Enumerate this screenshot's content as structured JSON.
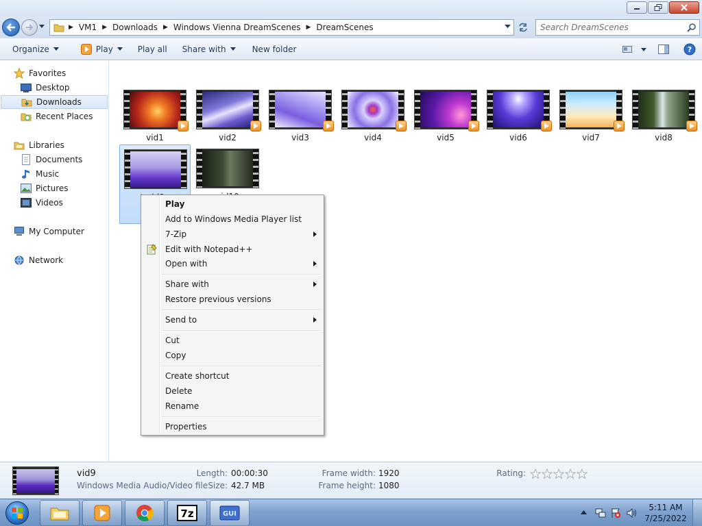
{
  "breadcrumb": [
    "VM1",
    "Downloads",
    "Windows Vienna DreamScenes",
    "DreamScenes"
  ],
  "search": {
    "placeholder": "Search DreamScenes"
  },
  "toolbar": {
    "organize": "Organize",
    "play": "Play",
    "play_all": "Play all",
    "share_with": "Share with",
    "new_folder": "New folder"
  },
  "nav": {
    "favorites": "Favorites",
    "desktop": "Desktop",
    "downloads": "Downloads",
    "recent_places": "Recent Places",
    "libraries": "Libraries",
    "documents": "Documents",
    "music": "Music",
    "pictures": "Pictures",
    "videos": "Videos",
    "my_computer": "My Computer",
    "network": "Network"
  },
  "files": [
    {
      "name": "vid1"
    },
    {
      "name": "vid2"
    },
    {
      "name": "vid3"
    },
    {
      "name": "vid4"
    },
    {
      "name": "vid5"
    },
    {
      "name": "vid6"
    },
    {
      "name": "vid7"
    },
    {
      "name": "vid8"
    },
    {
      "name": "vid9"
    },
    {
      "name": "vid10"
    }
  ],
  "context_menu": {
    "play": "Play",
    "add_wmp": "Add to Windows Media Player list",
    "seven_zip": "7-Zip",
    "notepadpp": "Edit with Notepad++",
    "open_with": "Open with",
    "share_with": "Share with",
    "restore": "Restore previous versions",
    "send_to": "Send to",
    "cut": "Cut",
    "copy": "Copy",
    "create_shortcut": "Create shortcut",
    "delete": "Delete",
    "rename": "Rename",
    "properties": "Properties"
  },
  "details": {
    "name": "vid9",
    "type": "Windows Media Audio/Video file",
    "length_label": "Length:",
    "length_value": "00:00:30",
    "size_label": "Size:",
    "size_value": "42.7 MB",
    "frame_width_label": "Frame width:",
    "frame_width_value": "1920",
    "frame_height_label": "Frame height:",
    "frame_height_value": "1080",
    "rating_label": "Rating:",
    "rating": 0
  },
  "taskbar": {
    "time": "5:11 AM",
    "date": "7/25/2022"
  },
  "colors": {
    "selection": "#c1dcfc",
    "accent": "#1f5bb5",
    "taskbar": "#7fa3cf"
  }
}
